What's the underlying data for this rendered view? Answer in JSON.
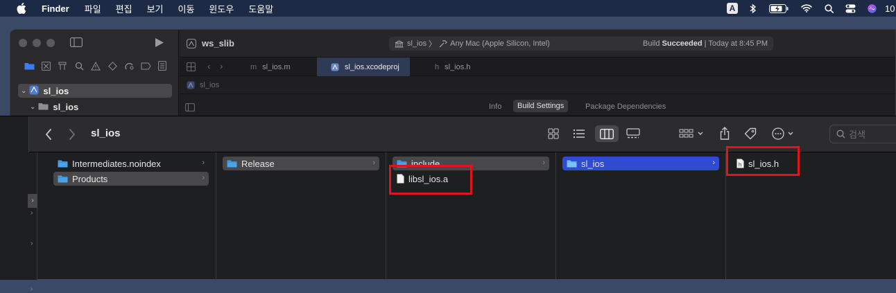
{
  "menubar": {
    "app_name": "Finder",
    "items": [
      "파일",
      "편집",
      "보기",
      "이동",
      "윈도우",
      "도움말"
    ],
    "status": {
      "input_source": "A",
      "clock_partial": "10"
    }
  },
  "xcode": {
    "project_name": "ws_slib",
    "activity": {
      "scheme": "sl_ios",
      "destination": "Any Mac (Apple Silicon, Intel)",
      "status_prefix": "Build",
      "status_bold": "Succeeded",
      "status_suffix": "| Today at 8:45 PM"
    },
    "tabs": [
      {
        "icon": "m",
        "label": "sl_ios.m"
      },
      {
        "icon": "xcodeproj",
        "label": "sl_ios.xcodeproj"
      },
      {
        "icon": "h",
        "label": "sl_ios.h"
      }
    ],
    "jump_bar": "sl_ios",
    "navigator": {
      "root": "sl_ios",
      "child": "sl_ios"
    },
    "settings_tabs": [
      "Info",
      "Build Settings",
      "Package Dependencies"
    ]
  },
  "finder": {
    "title": "sl_ios",
    "search_placeholder": "검색",
    "columns": [
      {
        "items": [
          "Intermediates.noindex",
          "Products"
        ]
      },
      {
        "items": [
          "Release"
        ]
      },
      {
        "items": [
          "include",
          "libsl_ios.a"
        ]
      },
      {
        "items": [
          "sl_ios"
        ]
      },
      {
        "items": [
          "sl_ios.h"
        ]
      }
    ]
  },
  "colors": {
    "highlight_box": "#e0151b",
    "selection_blue": "#2e4bd2",
    "menubar_bg": "#1d2a45",
    "folder": "#4aa3e6"
  }
}
